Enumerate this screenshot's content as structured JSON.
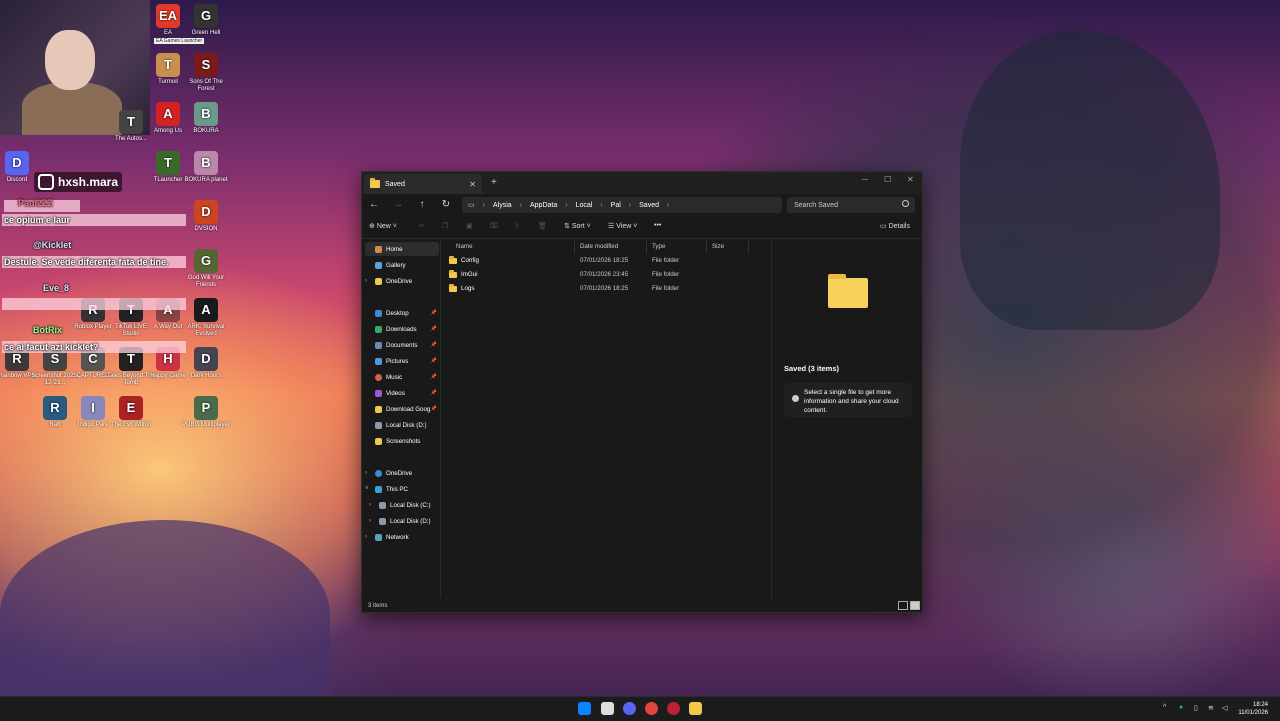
{
  "desktop": {
    "icons": [
      {
        "label": "EA",
        "color": "#e23a2a",
        "glyph": "EA"
      },
      {
        "label": "Green Hell",
        "color": "#333333",
        "glyph": "G"
      },
      {
        "label": "Turmoil",
        "color": "#c89050",
        "glyph": "T"
      },
      {
        "label": "Sons Of The Forest",
        "color": "#7a1a1a",
        "glyph": "S"
      },
      {
        "label": "Among Us",
        "color": "#d22222",
        "glyph": "A"
      },
      {
        "label": "BOKURA",
        "color": "#6a9a8a",
        "glyph": "B"
      },
      {
        "label": "Discord",
        "color": "#5865f2",
        "glyph": "D"
      },
      {
        "label": "Rainbow VPN",
        "color": "#3a3a3a",
        "glyph": "R"
      },
      {
        "label": "Screenshot 2025-12-23...",
        "color": "#444444",
        "glyph": "S"
      },
      {
        "label": "CAPTURED",
        "color": "#555555",
        "glyph": "C"
      },
      {
        "label": "Tales Beyond The Tomb",
        "color": "#222222",
        "glyph": "T"
      },
      {
        "label": "Happy Game",
        "color": "#cc3344",
        "glyph": "H"
      },
      {
        "label": "Dark Hours",
        "color": "#444455",
        "glyph": "D"
      },
      {
        "label": "Raft",
        "color": "#2a5a80",
        "glyph": "R"
      },
      {
        "label": "Indigo Park",
        "color": "#8888bb",
        "glyph": "I"
      },
      {
        "label": "The Evil Within",
        "color": "#aa2222",
        "glyph": "E"
      },
      {
        "label": "PUBG Multiplayer",
        "color": "#4a6a4a",
        "glyph": "P"
      },
      {
        "label": "Roblox Player",
        "color": "#333333",
        "glyph": "R"
      },
      {
        "label": "TikTok LIVE Studio",
        "color": "#222222",
        "glyph": "T"
      },
      {
        "label": "A Way Out",
        "color": "#884444",
        "glyph": "A"
      },
      {
        "label": "ARK: Survival Evolved",
        "color": "#1a1a1a",
        "glyph": "A"
      },
      {
        "label": "DVSION",
        "color": "#cc4422",
        "glyph": "D"
      },
      {
        "label": "God Will Your Friends",
        "color": "#556633",
        "glyph": "G"
      },
      {
        "label": "TLauncher",
        "color": "#3a6a2a",
        "glyph": "T"
      },
      {
        "label": "BOKURA planet",
        "color": "#bb88aa",
        "glyph": "B"
      },
      {
        "label": "The Autos...",
        "color": "#444444",
        "glyph": "T"
      }
    ],
    "tooltip": "EA Games Launcher",
    "instagram": "hxsh.mara",
    "chat": [
      {
        "user": "Paul2ZZ",
        "msg": ""
      },
      {
        "user": "",
        "msg": "ce opium e laur"
      },
      {
        "user": "@Kicklet",
        "msg": ""
      },
      {
        "user": "",
        "msg": "Destule. Se vede diferența fata de tine."
      },
      {
        "user": "Eve_8",
        "msg": ""
      },
      {
        "user": "BotRix",
        "msg": ""
      },
      {
        "user": "",
        "msg": "ce ai facut azi kicklet?"
      }
    ]
  },
  "explorer": {
    "tab_title": "Saved",
    "breadcrumb": [
      "Alysia",
      "AppData",
      "Local",
      "Pal",
      "Saved"
    ],
    "search_placeholder": "Search Saved",
    "toolbar": {
      "new": "New",
      "sort": "Sort",
      "view": "View",
      "details": "Details"
    },
    "nav": {
      "home": "Home",
      "gallery": "Gallery",
      "onedrive": "OneDrive",
      "desktop": "Desktop",
      "downloads": "Downloads",
      "documents": "Documents",
      "pictures": "Pictures",
      "music": "Music",
      "videos": "Videos",
      "download_goog": "Download Goog",
      "local_disk_d": "Local Disk (D:)",
      "screenshots": "Screenshots",
      "onedrive2": "OneDrive",
      "this_pc": "This PC",
      "local_disk_c": "Local Disk (C:)",
      "local_disk_d2": "Local Disk (D:)",
      "network": "Network"
    },
    "columns": {
      "name": "Name",
      "date": "Date modified",
      "type": "Type",
      "size": "Size"
    },
    "files": [
      {
        "name": "Config",
        "date": "07/01/2026 18:25",
        "type": "File folder"
      },
      {
        "name": "ImGui",
        "date": "07/01/2026 23:45",
        "type": "File folder"
      },
      {
        "name": "Logs",
        "date": "07/01/2026 18:25",
        "type": "File folder"
      }
    ],
    "details": {
      "title": "Saved (3 items)",
      "info": "Select a single file to get more information and share your cloud content."
    },
    "status": "3 items"
  },
  "taskbar": {
    "time": "18:24",
    "date": "11/01/2026",
    "accent": "#0a84ff"
  }
}
